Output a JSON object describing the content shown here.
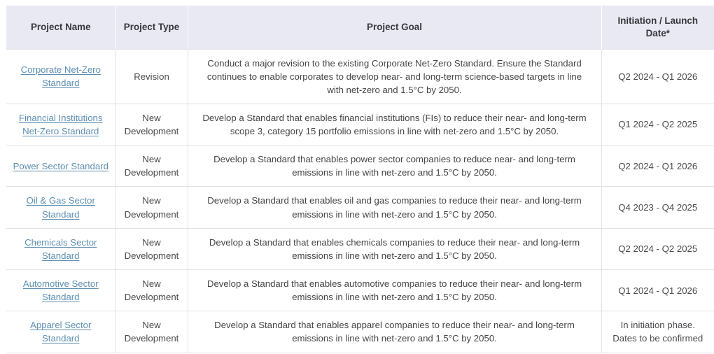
{
  "table": {
    "columns": [
      {
        "key": "name",
        "label": "Project Name"
      },
      {
        "key": "type",
        "label": "Project Type"
      },
      {
        "key": "goal",
        "label": "Project Goal"
      },
      {
        "key": "date",
        "label": "Initiation / Launch Date*"
      }
    ],
    "rows": [
      {
        "name": "Corporate Net-Zero Standard",
        "type": "Revision",
        "goal": "Conduct a major revision to the existing Corporate Net-Zero Standard. Ensure the Standard continues to enable corporates to develop near- and long-term science-based targets in line with net-zero and 1.5°C by 2050.",
        "date": "Q2 2024 - Q1 2026"
      },
      {
        "name": "Financial Institutions Net-Zero Standard",
        "type": "New Development",
        "goal": "Develop a Standard that enables financial institutions (FIs) to reduce their near- and long-term scope 3, category 15 portfolio emissions in line with net-zero and 1.5°C by 2050.",
        "date": "Q1 2024 - Q2 2025"
      },
      {
        "name": "Power Sector Standard",
        "type": "New Development",
        "goal": "Develop a Standard that enables power sector companies to reduce near- and long-term emissions in line with net-zero and 1.5°C by 2050.",
        "date": "Q2 2024 - Q1 2026"
      },
      {
        "name": "Oil & Gas Sector Standard",
        "type": "New Development",
        "goal": "Develop a Standard that enables oil and gas companies to reduce their near- and long-term emissions in line with net-zero and 1.5°C by 2050.",
        "date": "Q4 2023 - Q4 2025"
      },
      {
        "name": "Chemicals Sector Standard",
        "type": "New Development",
        "goal": "Develop a Standard that enables chemicals companies to reduce their near- and long-term emissions in line with net-zero and 1.5°C by 2050.",
        "date": "Q2 2024 - Q2 2025"
      },
      {
        "name": "Automotive Sector Standard",
        "type": "New Development",
        "goal": "Develop a Standard that enables automotive companies to reduce their near- and long-term emissions in line with net-zero and 1.5°C by 2050.",
        "date": "Q1 2024 - Q1 2026"
      },
      {
        "name": "Apparel Sector Standard",
        "type": "New Development",
        "goal": "Develop a Standard that enables apparel companies to reduce their near- and long-term emissions in line with net-zero and 1.5°C by 2050.",
        "date": "In initiation phase. Dates to be confirmed"
      }
    ]
  },
  "colors": {
    "header_background": "#e9e9f3",
    "header_text": "#37373c",
    "body_text": "#4a4a4f",
    "link": "#5e8fb3",
    "border": "#e2e2e6",
    "page_background": "#ffffff"
  }
}
